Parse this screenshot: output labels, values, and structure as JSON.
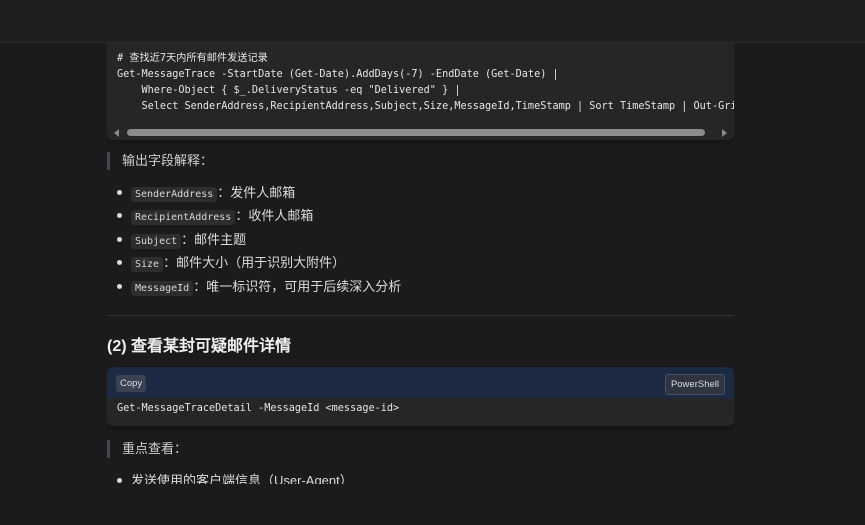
{
  "code_block_1": {
    "lines": [
      "# 查找近7天内所有邮件发送记录",
      "Get-MessageTrace -StartDate (Get-Date).AddDays(-7) -EndDate (Get-Date) |",
      "    Where-Object { $_.DeliveryStatus -eq \"Delivered\" } |",
      "    Select SenderAddress,RecipientAddress,Subject,Size,MessageId,TimeStamp | Sort TimeStamp | Out-GridView"
    ]
  },
  "quote_1": "输出字段解释：",
  "fields": [
    {
      "code": "SenderAddress",
      "desc": "：发件人邮箱"
    },
    {
      "code": "RecipientAddress",
      "desc": "：收件人邮箱"
    },
    {
      "code": "Subject",
      "desc": "：邮件主题"
    },
    {
      "code": "Size",
      "desc": "：邮件大小（用于识别大附件）"
    },
    {
      "code": "MessageId",
      "desc": "：唯一标识符，可用于后续深入分析"
    }
  ],
  "heading_2": "(2) 查看某封可疑邮件详情",
  "code_block_2": {
    "copy_label": "Copy",
    "lang_label": "PowerShell",
    "lines": [
      "Get-MessageTraceDetail -MessageId <message-id>"
    ]
  },
  "quote_2": "重点查看：",
  "partial_bullet": "发送使用的客户端信息（User-Agent）"
}
